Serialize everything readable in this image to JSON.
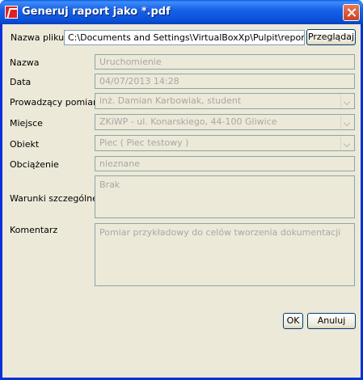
{
  "window": {
    "title": "Generuj raport jako *.pdf"
  },
  "file": {
    "label": "Nazwa pliku",
    "value": "C:\\Documents and Settings\\VirtualBoxXp\\Pulpit\\report.pdf",
    "browse_label": "Przeglądaj"
  },
  "fields": {
    "nazwa": {
      "label": "Nazwa",
      "value": "Uruchomienie"
    },
    "data": {
      "label": "Data",
      "value": "04/07/2013 14:28"
    },
    "prowadzacy": {
      "label": "Prowadzący pomiary",
      "value": "inż. Damian Karbowiak, student"
    },
    "miejsce": {
      "label": "Miejsce",
      "value": "ZKiWP - ul. Konarskiego, 44-100 Gliwice"
    },
    "obiekt": {
      "label": "Obiekt",
      "value": "Piec ( Piec testowy )"
    },
    "obciazenie": {
      "label": "Obciążenie",
      "value": "nieznane"
    },
    "warunki": {
      "label": "Warunki szczególne",
      "value": "Brak"
    },
    "komentarz": {
      "label": "Komentarz",
      "value": "Pomiar przykładowy do celów tworzenia dokumentacji"
    }
  },
  "buttons": {
    "ok": "OK",
    "cancel": "Anuluj"
  },
  "colors": {
    "titlebar": "#0a5ce6",
    "background": "#ece9d8",
    "disabled_text": "#a7a7a7"
  }
}
